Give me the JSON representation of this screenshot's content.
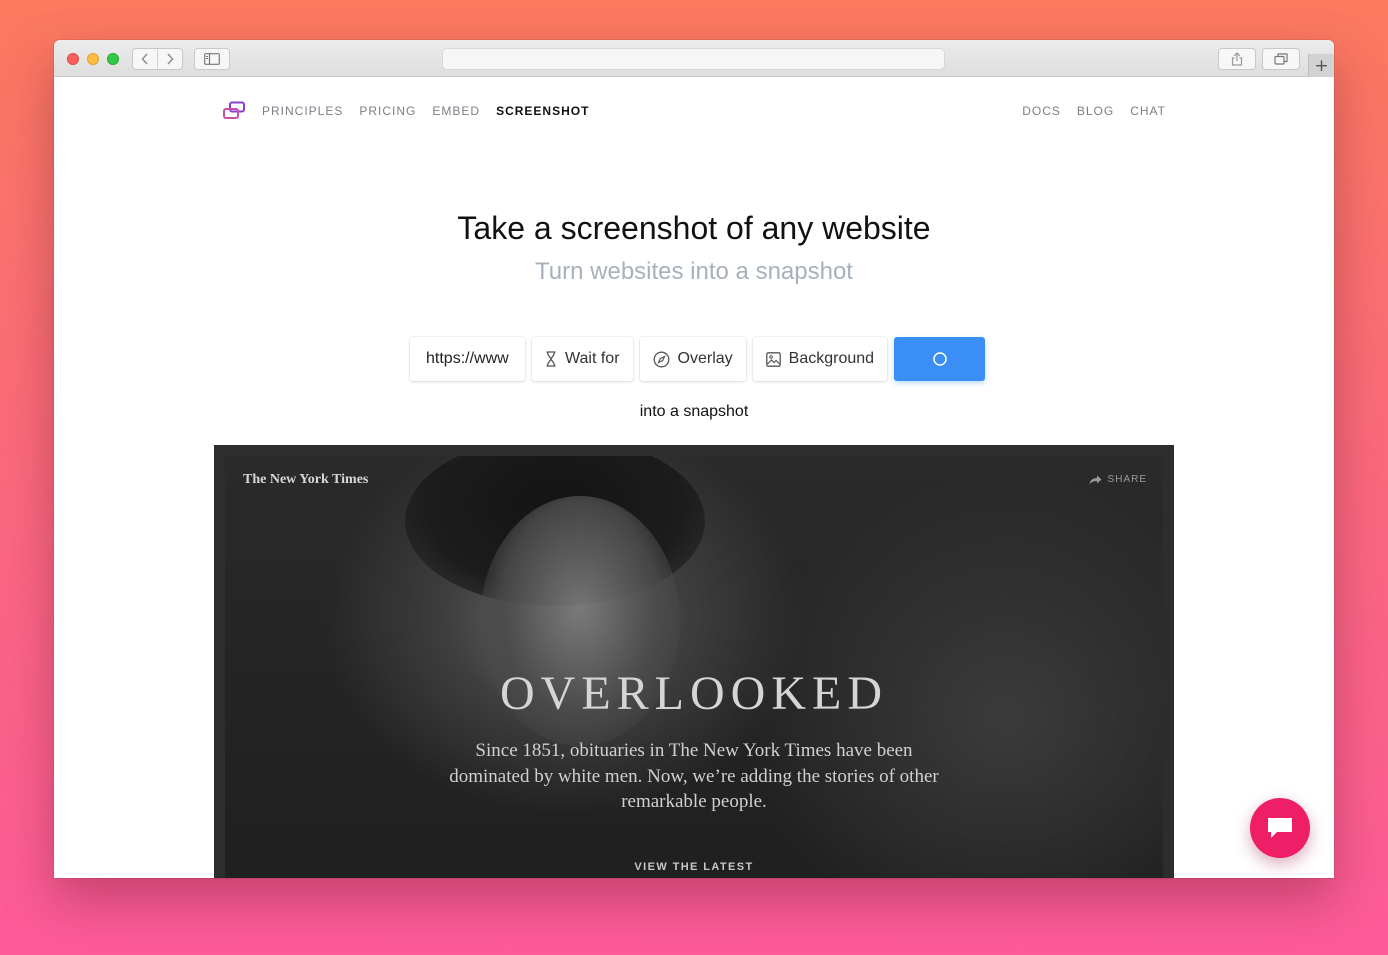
{
  "browser": {
    "address": "",
    "new_tab_label": "+"
  },
  "site": {
    "nav_left": [
      "PRINCIPLES",
      "PRICING",
      "EMBED",
      "SCREENSHOT"
    ],
    "nav_active": "SCREENSHOT",
    "nav_right": [
      "DOCS",
      "BLOG",
      "CHAT"
    ]
  },
  "hero": {
    "title": "Take a screenshot of any website",
    "subtitle": "Turn websites into a snapshot"
  },
  "controls": {
    "url_value": "https://www.nytimes.com",
    "wait_for_label": "Wait for",
    "overlay_label": "Overlay",
    "background_label": "Background",
    "accent_color": "#3a8ef6"
  },
  "caption": "into a snapshot",
  "preview": {
    "logo_text": "The New York Times",
    "share_label": "SHARE",
    "headline": "OVERLOOKED",
    "blurb": "Since 1851, obituaries in The New York Times have been dominated by white men. Now, we’re adding the stories of other remarkable people.",
    "cta": "VIEW THE LATEST"
  },
  "chat_widget": {
    "icon": "chat-bubble-icon",
    "color": "#ee1f67"
  }
}
